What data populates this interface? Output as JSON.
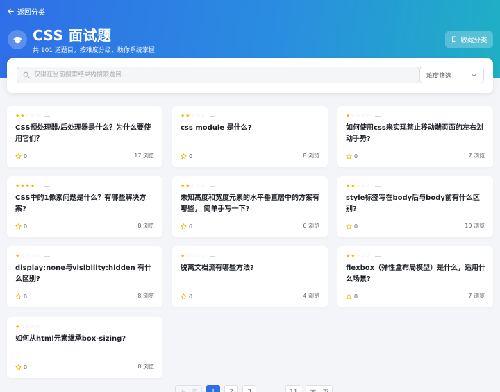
{
  "header": {
    "back_label": "返回分类",
    "title": "CSS 面试题",
    "subtitle": "共 101 道题目，按难度分级，助你系统掌握",
    "fav_label": "收藏分类"
  },
  "filter": {
    "search_placeholder": "仅限在当前搜索结果内搜索题目...",
    "difficulty_label": "难度筛选"
  },
  "cards": [
    {
      "stars": 2,
      "question": "CSS预处理器/后处理器是什么？为什么要使用它们？",
      "likes": "0",
      "views": "17 浏览"
    },
    {
      "stars": 2,
      "question": "css module 是什么?",
      "likes": "0",
      "views": "8 浏览"
    },
    {
      "stars": 1,
      "question": "如何使用css来实现禁止移动端页面的左右划动手势?",
      "likes": "0",
      "views": "7 浏览"
    },
    {
      "stars": 4,
      "question": "CSS中的1像素问题是什么？有哪些解决方案?",
      "likes": "0",
      "views": "8 浏览"
    },
    {
      "stars": 2,
      "question": "未知高度和宽度元素的水平垂直居中的方案有哪些， 简单手写一下?",
      "likes": "0",
      "views": "6 浏览"
    },
    {
      "stars": 2,
      "question": "style标签写在body后与body前有什么区别?",
      "likes": "0",
      "views": "10 浏览"
    },
    {
      "stars": 1,
      "question": "display:none与visibility:hidden 有什么区别?",
      "likes": "0",
      "views": "8 浏览"
    },
    {
      "stars": 1,
      "question": "脱离文档流有哪些方法?",
      "likes": "0",
      "views": "4 浏览"
    },
    {
      "stars": 2,
      "question": "flexbox（弹性盒布局模型）是什么，适用什么场景?",
      "likes": "0",
      "views": "7 浏览"
    },
    {
      "stars": 1,
      "question": "如何从html元素继承box-sizing?",
      "likes": "0",
      "views": "8 浏览"
    }
  ],
  "pagination": {
    "prev": "上一页",
    "pages": [
      "1",
      "2",
      "3"
    ],
    "ellipsis": "...",
    "last": "11",
    "next": "下一页",
    "current": "1"
  },
  "colors": {
    "primary": "#2f6ee8",
    "star": "#f5b400"
  }
}
